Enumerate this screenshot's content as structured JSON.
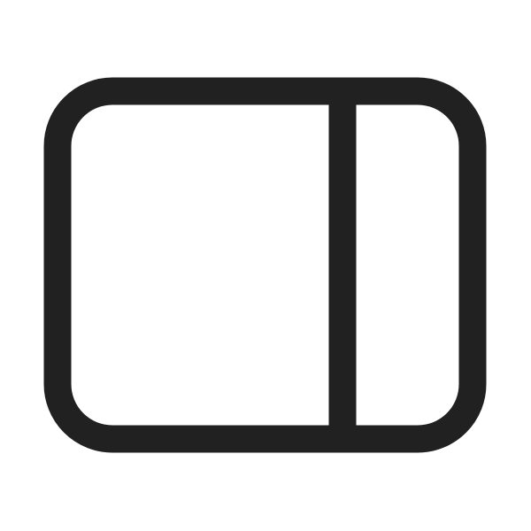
{
  "icon": {
    "name": "panel-right-icon",
    "stroke_color": "#212121",
    "background_color": "#ffffff"
  }
}
